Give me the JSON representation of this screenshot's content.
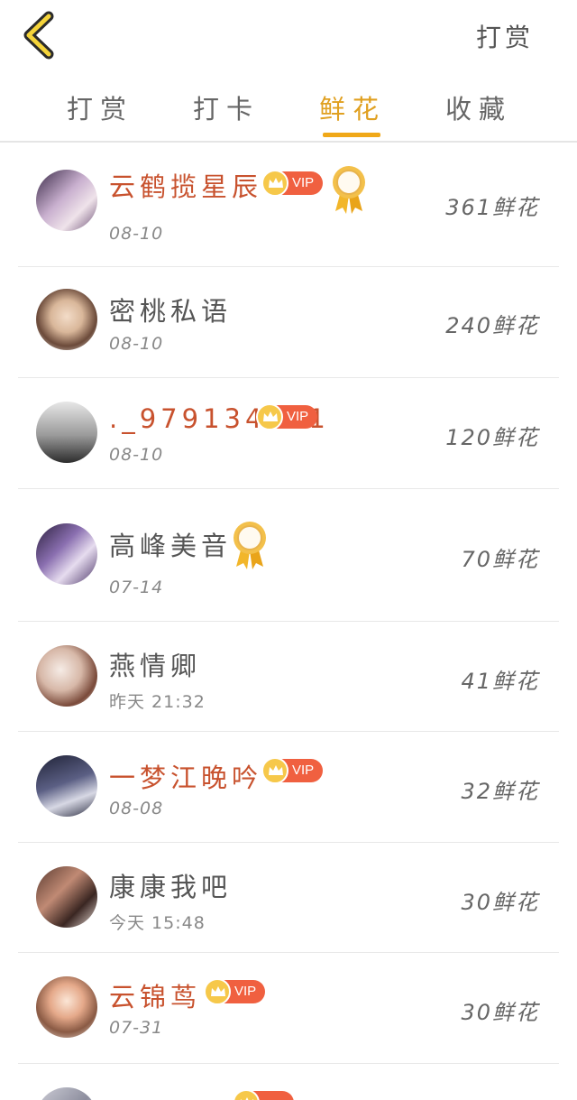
{
  "header": {
    "back_icon": "chevron-left-icon",
    "action_label": "打赏"
  },
  "tabs": [
    {
      "label": "打赏",
      "active": false
    },
    {
      "label": "打卡",
      "active": false
    },
    {
      "label": "鲜花",
      "active": true
    },
    {
      "label": "收藏",
      "active": false
    }
  ],
  "colors": {
    "accent": "#f0a818",
    "vip_name": "#c8522e",
    "vip_badge": "#f06040"
  },
  "vip_label": "VIP",
  "list": [
    {
      "name": "云鹤揽星辰",
      "date": "08-10",
      "count": "361鲜花",
      "vip": true,
      "medal": true
    },
    {
      "name": "密桃私语",
      "date": "08-10",
      "count": "240鲜花",
      "vip": false,
      "medal": false
    },
    {
      "name": "._979134431",
      "date": "08-10",
      "count": "120鲜花",
      "vip": true,
      "medal": false
    },
    {
      "name": "高峰美音",
      "date": "07-14",
      "count": "70鲜花",
      "vip": false,
      "medal": true
    },
    {
      "name": "燕情卿",
      "date": "昨天 21:32",
      "count": "41鲜花",
      "vip": false,
      "medal": false
    },
    {
      "name": "一梦江晚吟",
      "date": "08-08",
      "count": "32鲜花",
      "vip": true,
      "medal": false
    },
    {
      "name": "康康我吧",
      "date": "今天 15:48",
      "count": "30鲜花",
      "vip": false,
      "medal": false
    },
    {
      "name": "云锦茑",
      "date": "07-31",
      "count": "30鲜花",
      "vip": true,
      "medal": false
    }
  ]
}
